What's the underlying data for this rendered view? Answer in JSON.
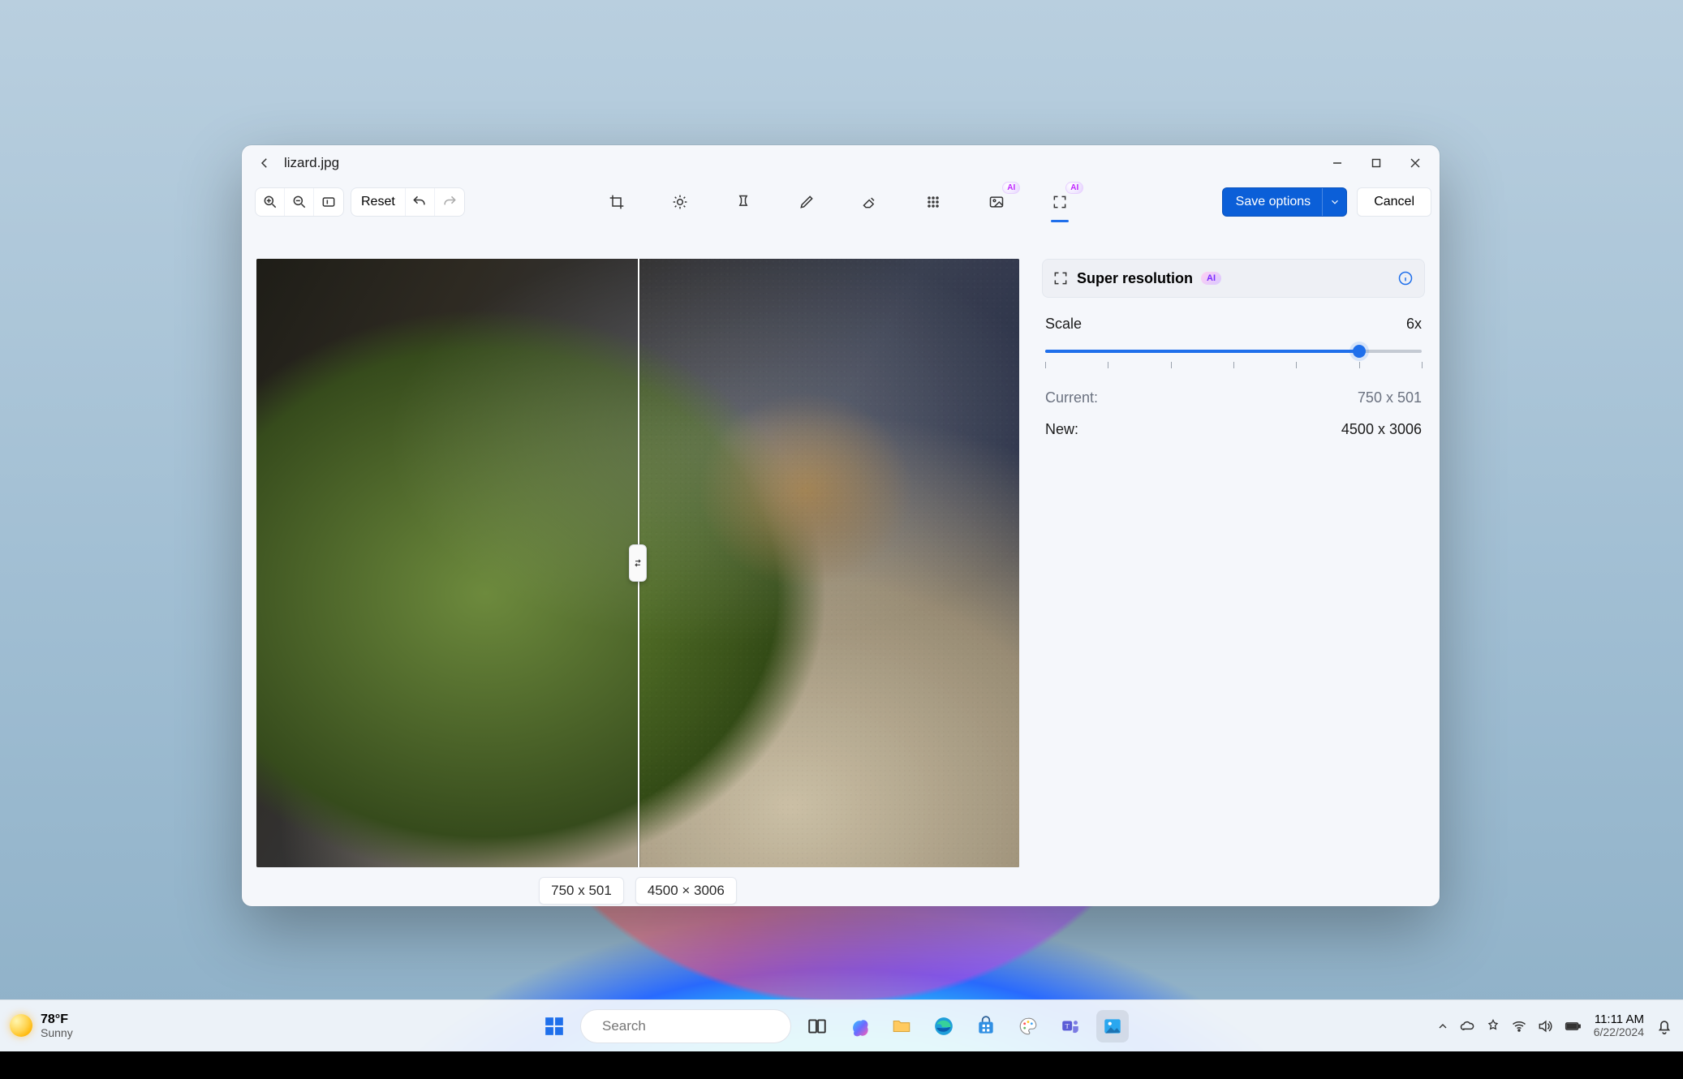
{
  "colors": {
    "accent": "#0b5fd8",
    "accent2": "#1f6feb"
  },
  "window": {
    "filename": "lizard.jpg"
  },
  "toolbar": {
    "reset_label": "Reset",
    "save_label": "Save options",
    "cancel_label": "Cancel",
    "ai_badge": "AI"
  },
  "canvas": {
    "left_dim": "750 x 501",
    "right_dim": "4500 × 3006"
  },
  "panel": {
    "title": "Super resolution",
    "ai_badge": "AI",
    "scale_label": "Scale",
    "scale_value": "6x",
    "slider": {
      "min": 1,
      "max": 7,
      "value": 6,
      "ticks": [
        1,
        2,
        3,
        4,
        5,
        6,
        7
      ]
    },
    "current_label": "Current:",
    "current_value": "750 x 501",
    "new_label": "New:",
    "new_value": "4500 x 3006"
  },
  "taskbar": {
    "weather": {
      "temp": "78°F",
      "cond": "Sunny"
    },
    "search_placeholder": "Search",
    "clock": {
      "time": "11:11 AM",
      "date": "6/22/2024"
    }
  }
}
